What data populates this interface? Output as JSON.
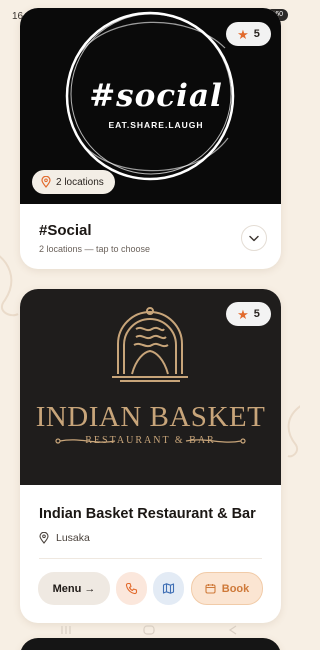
{
  "status_bar": {
    "time": "16",
    "battery": "60"
  },
  "colors": {
    "background": "#f7efe4",
    "accent": "#e26a2c",
    "book_accent": "#cf7a3a",
    "logo_gold": "#c8a57a"
  },
  "cards": [
    {
      "rating": "5",
      "logo": {
        "main": "#social",
        "tagline": "EAT.SHARE.LAUGH"
      },
      "locations_chip": "2 locations",
      "title": "#Social",
      "subtitle": "2 locations — tap to choose",
      "icons": [
        "star-icon",
        "map-pin-icon",
        "chevron-down-icon"
      ]
    },
    {
      "rating": "5",
      "logo": {
        "main": "INDIAN BASKET",
        "tagline": "RESTAURANT & BAR"
      },
      "title": "Indian Basket Restaurant & Bar",
      "location": "Lusaka",
      "actions": {
        "menu_label": "Menu →",
        "book_label": "Book"
      },
      "icons": [
        "star-icon",
        "map-pin-icon",
        "phone-icon",
        "map-icon",
        "calendar-icon"
      ]
    }
  ]
}
